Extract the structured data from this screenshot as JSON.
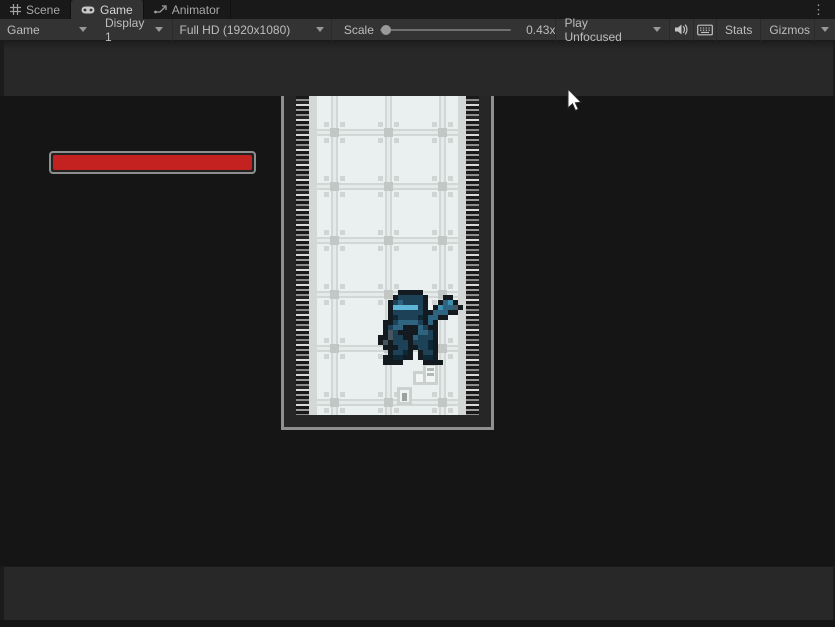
{
  "tabs": {
    "scene": "Scene",
    "game": "Game",
    "animator": "Animator",
    "active_tab": "Game"
  },
  "window_menu": {
    "icon": "kebab-vertical"
  },
  "toolbar": {
    "game_menu": "Game",
    "display": "Display 1",
    "resolution": "Full HD (1920x1080)",
    "scale_label": "Scale",
    "scale_value": "0.43x",
    "play_mode": "Play Unfocused",
    "stats_label": "Stats",
    "gizmos_label": "Gizmos",
    "icons": {
      "audio": "speaker-icon",
      "input": "keyboard-icon",
      "dropdown": "caret-down"
    }
  },
  "game_view": {
    "health_bar": {
      "fill_color": "#c42121",
      "border_color": "#8e8e8e",
      "fill_percent": 100
    },
    "level": {
      "description": "vertical tower with tiled grid walls and chain edges"
    },
    "sprite": {
      "name": "knight-with-axe",
      "pixel_size": 5,
      "palette": {
        "K": "#131b20",
        "N": "#0e2735",
        "D": "#1d4258",
        "M": "#2e6480",
        "L": "#3e8fb0",
        "C": "#5cb4d6",
        "G": "#47565e",
        "S": "#93a5ac"
      },
      "rows": [
        "....KKKKK........",
        "...KDDDDDK...KK..",
        "..KDMDDDDK..KMLK.",
        "..KCCCCCDK.KLMMGK",
        "..KDDDDDDKKMMMKK.",
        "..KNDDDDNKMMKK...",
        ".KKDMMMMDKMK.....",
        ".KDMMKKKMDKK.....",
        ".KGDKKKKMMDK.....",
        "KKGDDKKMDDDK.....",
        "KGKDDDKDDDNK.....",
        ".KKKDDKKDDNK.....",
        "..KDDNK.KDDK.....",
        ".KKNNKK.KNNK.....",
        ".KKKK....KKKK...."
      ]
    }
  }
}
